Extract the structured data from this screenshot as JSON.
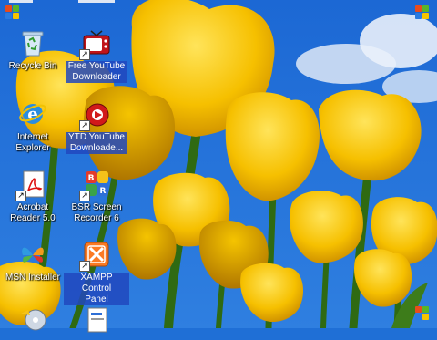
{
  "desktop": {
    "icons": [
      {
        "name": "recycle-bin",
        "label": "Recycle Bin",
        "icon": "recycle-bin-icon",
        "shortcut": false
      },
      {
        "name": "free-youtube-downloader",
        "label": "Free YouTube\nDownloader",
        "icon": "tv-icon",
        "shortcut": true
      },
      {
        "name": "internet-explorer",
        "label": "Internet\nExplorer",
        "icon": "internet-explorer-icon",
        "shortcut": false
      },
      {
        "name": "ytd-youtube-downloader",
        "label": "YTD YouTube\nDownloade...",
        "icon": "ytd-icon",
        "shortcut": true
      },
      {
        "name": "acrobat-reader",
        "label": "Acrobat\nReader 5.0",
        "icon": "acrobat-icon",
        "shortcut": true
      },
      {
        "name": "bsr-screen-recorder",
        "label": "BSR Screen\nRecorder 6",
        "icon": "bsr-icon",
        "shortcut": true
      },
      {
        "name": "msn-installer",
        "label": "MSN Installer",
        "icon": "msn-butterfly-icon",
        "shortcut": false
      },
      {
        "name": "xampp-control-panel",
        "label": "XAMPP Control\nPanel",
        "icon": "xampp-icon",
        "shortcut": true
      }
    ],
    "colors": {
      "sky": "#1f6fd6",
      "petal": "#f7c400",
      "stem": "#2f6a12",
      "selection": "#2148be"
    }
  }
}
